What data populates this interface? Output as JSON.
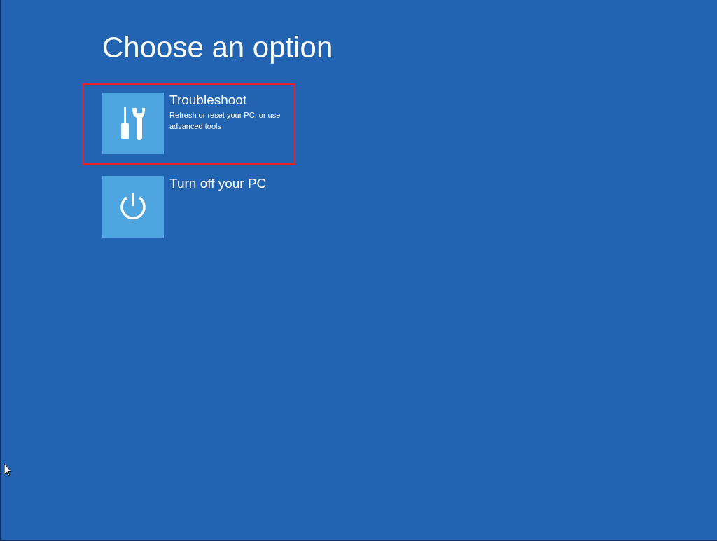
{
  "title": "Choose an option",
  "options": [
    {
      "kind": "tools",
      "label": "Troubleshoot",
      "description": "Refresh or reset your PC, or use advanced tools",
      "highlighted": true
    },
    {
      "kind": "power",
      "label": "Turn off your PC",
      "highlighted": false
    }
  ]
}
